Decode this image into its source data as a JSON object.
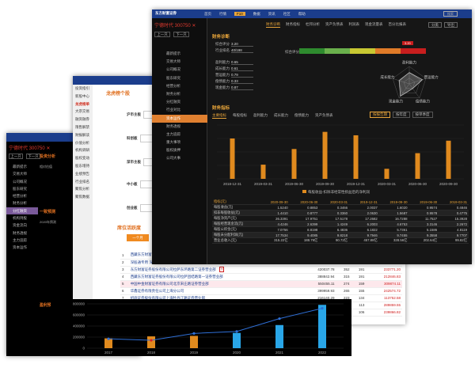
{
  "colors": {
    "titlebar": "#1b3d8c",
    "accent": "#e08030",
    "bar": "#e08a1e",
    "blue_bar": "#29a6e8",
    "red": "#d02020"
  },
  "back_window": {
    "stock_title": "宁德时代 300750 ✕",
    "nav_prev": "上一只",
    "nav_next": "下一只",
    "sidebar": [
      "最新提示",
      "交易大师",
      "公司概况",
      "股东研究",
      "经营分析",
      "财务分析",
      "分红融资",
      "机构持股",
      "资金流向",
      "财务透视",
      "主力追踪",
      "资本运作"
    ],
    "sidebar_active": 6,
    "section_1": "投资分析",
    "label_1": "相对估值",
    "section_2": "一致预测",
    "label_2": "2020年预测",
    "section_3": "盈利预测"
  },
  "middle_window": {
    "sidebar": [
      "投资指引",
      "新股中心",
      "龙虎榜单",
      "大宗交易",
      "融资融券",
      "限售解禁",
      "财报解读",
      "价值分析",
      "机构调研",
      "股权变动",
      "股东增持",
      "业绩预告",
      "行业排名",
      "聚焦分析",
      "聚焦数据"
    ],
    "sidebar_active": 2,
    "header": "龙虎榜个股",
    "chips": [
      "沪市主板",
      "科创板",
      "深市主板",
      "中小板",
      "创业板"
    ],
    "section_2": "席位活跃度",
    "btn_1": "一个月",
    "btn_2": "三个月",
    "institutions": [
      {
        "no": "1",
        "name": "西藏东方财富证券股份有限公司拉萨团结路第二证券营业部",
        "tag": "T",
        "amount": "835604.20",
        "a": "725",
        "b": "399",
        "c": "445845.72"
      },
      {
        "no": "2",
        "name": "深股通专用 深股通专用",
        "tag": "",
        "amount": "5392225.79",
        "a": "417",
        "b": "210",
        "c": "4080821.77"
      },
      {
        "no": "3",
        "name": "东方财富证券股份有限公司拉萨东环路第二证券营业部",
        "tag": "T",
        "amount": "420037.78",
        "a": "352",
        "b": "191",
        "c": "233771.20"
      },
      {
        "no": "4",
        "name": "西藏东方财富证券股份有限公司拉萨团结路第一证券营业部",
        "tag": "",
        "amount": "388842.94",
        "a": "315",
        "b": "191",
        "c": "212846.83"
      },
      {
        "no": "5",
        "name": "中国中金财富证券有限公司北京宋庄路证券营业部",
        "tag": "",
        "amount": "550455.11",
        "a": "274",
        "b": "159",
        "c": "309874.11"
      },
      {
        "no": "6",
        "name": "华鑫证券有限责任公司上海分公司",
        "tag": "",
        "amount": "399959.93",
        "a": "265",
        "b": "155",
        "c": "242574.72"
      },
      {
        "no": "7",
        "name": "招商证券股份有限公司上海牡丹江路证券营业部",
        "tag": "",
        "amount": "216140.29",
        "a": "223",
        "b": "134",
        "c": "113752.58"
      },
      {
        "no": "8",
        "name": "华泰证券股份有限公司总部",
        "tag": "",
        "amount": "517184.93",
        "a": "209",
        "b": "113",
        "c": "289859.55"
      },
      {
        "no": "9",
        "name": "国泰君安证券股份有限公司深圳深南路证券营业部",
        "tag": "",
        "amount": "427491.07",
        "a": "204",
        "b": "106",
        "c": "239866.82"
      }
    ],
    "highlight_row": 4
  },
  "bottom_chart": {
    "y_ticks": [
      "800000",
      "600000",
      "400000",
      "200000",
      "0"
    ],
    "x_ticks": [
      "2017",
      "2018",
      "2019",
      "2020",
      "2021",
      "2022"
    ]
  },
  "chart_data": [
    {
      "type": "bar",
      "title": "",
      "categories": [
        "2017",
        "2018",
        "2019",
        "2020",
        "2021",
        "2022"
      ],
      "ylim": [
        0,
        900000
      ],
      "series": [
        {
          "values": [
            200000,
            240000,
            250000,
            310000,
            470000,
            880000
          ]
        },
        {
          "values": [
            190000,
            160000,
            300000,
            340000,
            600000,
            810000
          ]
        }
      ]
    },
    {
      "type": "bar",
      "title": "",
      "categories": [
        "2018-12-31",
        "2019-03-31",
        "2019-06-30",
        "2019-09-30",
        "2019-12-31",
        "2020-03-31",
        "2020-06-30",
        "2020-09-30"
      ],
      "values": [
        1.65,
        0.58,
        1.22,
        1.92,
        1.78,
        0.41,
        1.05,
        1.56
      ],
      "ylim": [
        0,
        2.2
      ],
      "xlabel": "",
      "ylabel": ""
    },
    {
      "type": "radar",
      "axes": [
        "盈利能力",
        "营运能力",
        "偿债能力",
        "现金能力",
        "成长能力"
      ],
      "values": [
        0.65,
        0.79,
        0.33,
        0.87,
        0.61
      ]
    }
  ],
  "front_window": {
    "logo": "东方财富证券",
    "menu": [
      "首页",
      "行情",
      "F10",
      "数据",
      "资讯",
      "社区",
      "帮助"
    ],
    "menu_active": 2,
    "search": "搜索",
    "stock_title": "宁德时代 300750 ✕",
    "nav_prev": "上一只",
    "nav_next": "下一只",
    "sidebar": [
      "最新提示",
      "交易大师",
      "公司概况",
      "股东研究",
      "经营分析",
      "财务分析",
      "分红融资",
      "行业对比",
      "资本运作",
      "财务透视",
      "主力追踪",
      "重大事项",
      "股权质押",
      "公司大事"
    ],
    "sidebar_active": 8,
    "subtabs": [
      "财务诊断",
      "财务指标",
      "杜邦分析",
      "资产负债表",
      "利润表",
      "现金流量表",
      "百分比报表"
    ],
    "subtabs_active": 0,
    "tools": [
      "分类",
      "导出"
    ],
    "section_diag": "财务诊断",
    "diag_rows": [
      {
        "label": "综合评分",
        "value": "3.20"
      },
      {
        "label": "行业排名",
        "value": "40/198"
      },
      {
        "label": "盈利能力",
        "value": "0.65"
      },
      {
        "label": "成长能力",
        "value": "0.61"
      },
      {
        "label": "营运能力",
        "value": "0.79"
      },
      {
        "label": "偿债能力",
        "value": "0.33"
      },
      {
        "label": "现金能力",
        "value": "0.87"
      }
    ],
    "eval_label": "综合评分",
    "score_badge": "3.20",
    "section_idx": "财务指标",
    "chart_tabs": [
      "主要指标",
      "每股指标",
      "盈利能力",
      "成长能力",
      "偿债能力",
      "资产负债表"
    ],
    "chart_tabs_active": 0,
    "periods": [
      "按报告期",
      "按年度",
      "按单季度"
    ],
    "periods_active": 0,
    "legend": "每股收益-扣除非经常性损益后的净利润",
    "table_header": [
      "指标(元)",
      "2020-09-30",
      "2020-06-30",
      "2020-03-31",
      "2019-12-31",
      "2019-09-30",
      "2019-06-30",
      "2019-03-31"
    ],
    "table_rows": [
      [
        "每股收益(元)",
        "1.5240",
        "0.8853",
        "0.3466",
        "2.0037",
        "1.6020",
        "0.9574",
        "0.4846"
      ],
      [
        "扣非每股收益(元)",
        "1.4410",
        "0.8777",
        "0.3360",
        "2.0630",
        "1.5687",
        "0.9578",
        "0.4775"
      ],
      [
        "每股净资产(元)",
        "26.3391",
        "17.9751",
        "17.5178",
        "17.2682",
        "16.7288",
        "11.7527",
        "15.3928"
      ],
      [
        "每股经营现金流(元)",
        "4.4246",
        "2.6399",
        "1.4249",
        "6.2003",
        "4.6753",
        "3.3146",
        "2.2672"
      ],
      [
        "每股公积金(元)",
        "7.0756",
        "8.8198",
        "6.4836",
        "6.1822",
        "5.7361",
        "5.1586",
        "4.8119"
      ],
      [
        "每股未分配利润(元)",
        "17.7534",
        "9.4085",
        "9.8218",
        "9.7946",
        "9.7455",
        "9.3558",
        "9.7707"
      ],
      [
        "营业总收入(元)",
        "315.22亿",
        "188.79亿",
        "90.72亿",
        "457.88亿",
        "328.56亿",
        "202.64亿",
        "99.82亿"
      ]
    ]
  }
}
